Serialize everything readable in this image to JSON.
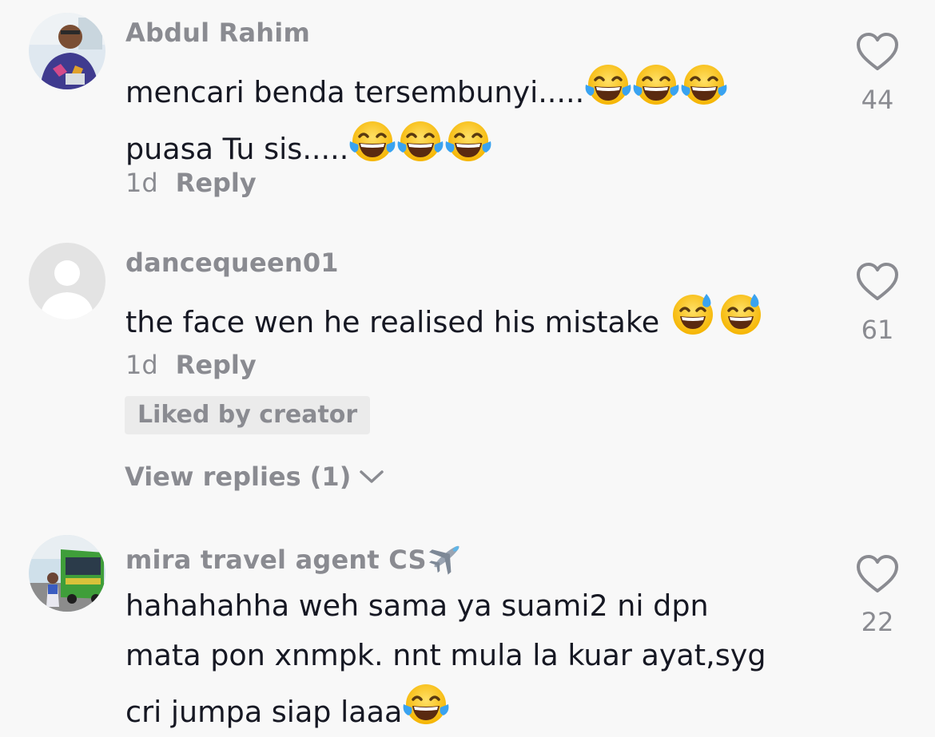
{
  "comments": [
    {
      "username": "Abdul Rahim",
      "line1": "mencari benda tersembunyi.....",
      "line1_emoji": [
        "face-with-tears-of-joy",
        "face-with-tears-of-joy",
        "face-with-tears-of-joy"
      ],
      "line2": "puasa Tu sis.....",
      "line2_emoji": [
        "face-with-tears-of-joy",
        "face-with-tears-of-joy",
        "face-with-tears-of-joy"
      ],
      "time": "1d",
      "reply_label": "Reply",
      "likes": "44"
    },
    {
      "username": "dancequeen01",
      "line1": "the face wen he realised his mistake ",
      "line1_emoji": [
        "grinning-face-with-sweat",
        "grinning-face-with-sweat"
      ],
      "time": "1d",
      "reply_label": "Reply",
      "likes": "61",
      "badge": "Liked by creator",
      "view_replies": "View replies (1)"
    },
    {
      "username": "mira travel agent CS",
      "username_emoji": "airplane",
      "line1": "hahahahha weh sama ya suami2 ni dpn",
      "line2": "mata pon xnmpk. nnt mula la kuar ayat,syg",
      "line3": "cri jumpa siap laaa",
      "line3_emoji": [
        "face-with-tears-of-joy"
      ],
      "likes": "22"
    }
  ],
  "colors": {
    "background": "#f8f8f8",
    "primary_text": "#161823",
    "secondary_text": "#8a8b91",
    "badge_bg": "#ebebeb"
  },
  "icons": {
    "like": "heart-outline-icon",
    "expand": "chevron-down-icon"
  }
}
